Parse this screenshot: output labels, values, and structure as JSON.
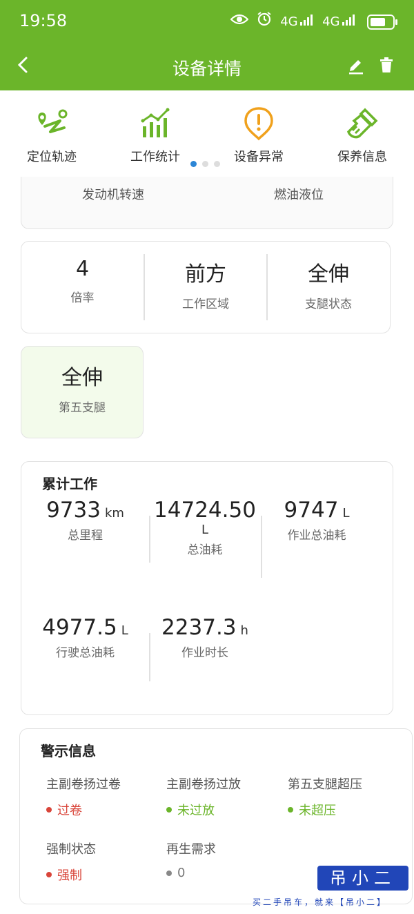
{
  "status_bar": {
    "time": "19:58",
    "network_1": "4G",
    "network_2": "4G",
    "battery_level": 0.7
  },
  "app_bar": {
    "title": "设备详情"
  },
  "quick_nav": [
    {
      "label": "定位轨迹",
      "icon": "location-track-icon"
    },
    {
      "label": "工作统计",
      "icon": "bar-chart-icon"
    },
    {
      "label": "设备异常",
      "icon": "warning-icon"
    },
    {
      "label": "保养信息",
      "icon": "maintenance-brush-icon"
    }
  ],
  "pager": {
    "active": 1,
    "count": 3
  },
  "partial_card": {
    "left_label": "发动机转速",
    "right_label": "燃油液位"
  },
  "mode_card": {
    "cells": [
      {
        "value": "4",
        "label": "倍率"
      },
      {
        "value": "前方",
        "label": "工作区域"
      },
      {
        "value": "全伸",
        "label": "支腿状态"
      }
    ]
  },
  "fifth_leg": {
    "value": "全伸",
    "label": "第五支腿"
  },
  "accumulated": {
    "title": "累计工作",
    "stats": [
      {
        "value": "9733",
        "unit": "km",
        "label": "总里程"
      },
      {
        "value": "14724.50",
        "unit": "L",
        "label": "总油耗"
      },
      {
        "value": "9747",
        "unit": "L",
        "label": "作业总油耗"
      },
      {
        "value": "4977.5",
        "unit": "L",
        "label": "行驶总油耗"
      },
      {
        "value": "2237.3",
        "unit": "h",
        "label": "作业时长"
      }
    ]
  },
  "warnings": {
    "title": "警示信息",
    "items": [
      {
        "label": "主副卷扬过卷",
        "value": "过卷",
        "status": "red"
      },
      {
        "label": "主副卷扬过放",
        "value": "未过放",
        "status": "green"
      },
      {
        "label": "第五支腿超压",
        "value": "未超压",
        "status": "green"
      },
      {
        "label": "强制状态",
        "value": "强制",
        "status": "red"
      },
      {
        "label": "再生需求",
        "value": "0",
        "status": "grey"
      }
    ]
  },
  "watermark": {
    "badge": "吊小二",
    "line": "买二手吊车，就来【吊小二】"
  },
  "colors": {
    "brand_green": "#6bb52a",
    "alert_red": "#d9453a",
    "dot_blue": "#2c86d6",
    "watermark_blue": "#2146b8"
  }
}
